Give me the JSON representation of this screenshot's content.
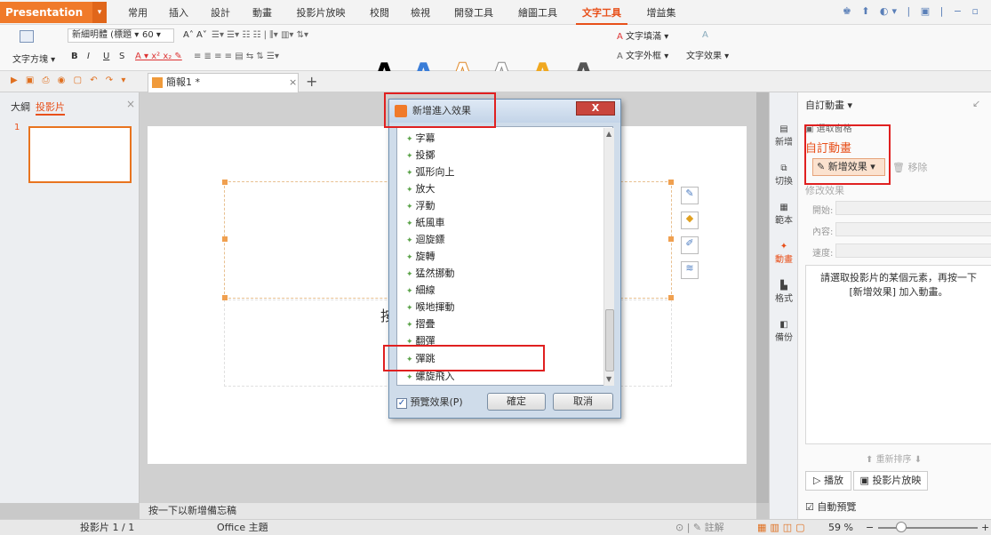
{
  "menubar": {
    "app_name": "Presentation",
    "tabs": [
      "常用",
      "插入",
      "設計",
      "動畫",
      "投影片放映",
      "校閱",
      "檢視",
      "開發工具",
      "繪圖工具",
      "文字工具",
      "增益集"
    ],
    "active_tab": "文字工具"
  },
  "ribbon": {
    "font_name": "新細明體 (標題",
    "font_size": "60",
    "text_direction": "文字方塊",
    "text_fill": "文字填滿",
    "text_outline": "文字外框",
    "text_effect": "文字效果",
    "bold": "B",
    "italic": "I",
    "underline": "U",
    "strike": "S",
    "styles_glyph": "A"
  },
  "document": {
    "tab_title": "簡報1 *",
    "new_tab": "+"
  },
  "left_panel": {
    "outline": "大綱",
    "slides": "投影片",
    "slide_number": "1"
  },
  "slide": {
    "placeholder_partial": "按"
  },
  "notes": {
    "placeholder": "按一下以新增備忘稿"
  },
  "dialog": {
    "title": "新增進入效果",
    "close": "X",
    "items": [
      "字幕",
      "投擲",
      "弧形向上",
      "放大",
      "浮動",
      "紙風車",
      "迴旋鏢",
      "旋轉",
      "猛然挪動",
      "細線",
      "喉地揮動",
      "摺疊",
      "翻彈",
      "彈跳",
      "螺旋飛入"
    ],
    "preview_label": "預覽效果(P)",
    "preview_checked": true,
    "ok": "確定",
    "cancel": "取消"
  },
  "right_tabs": [
    "新增",
    "切換",
    "範本",
    "動畫",
    "格式",
    "備份"
  ],
  "pane": {
    "header": "自訂動畫",
    "select_pane": "選取窗格",
    "section": "自訂動畫",
    "add_effect": "新增效果",
    "remove": "移除",
    "modify": "修改效果",
    "start": "開始:",
    "content": "內容:",
    "speed": "速度:",
    "hint": "請選取投影片的某個元素，再按一下 [新增效果] 加入動畫。",
    "reorder": "重新排序",
    "play": "播放",
    "slideshow": "投影片放映",
    "auto_preview": "自動預覽"
  },
  "status": {
    "slide": "投影片 1 / 1",
    "theme": "Office 主題",
    "notes": "註解",
    "zoom": "59 %"
  },
  "colors": {
    "brand": "#f07a2a",
    "accent": "#e8501a",
    "highlight": "#e02020"
  }
}
